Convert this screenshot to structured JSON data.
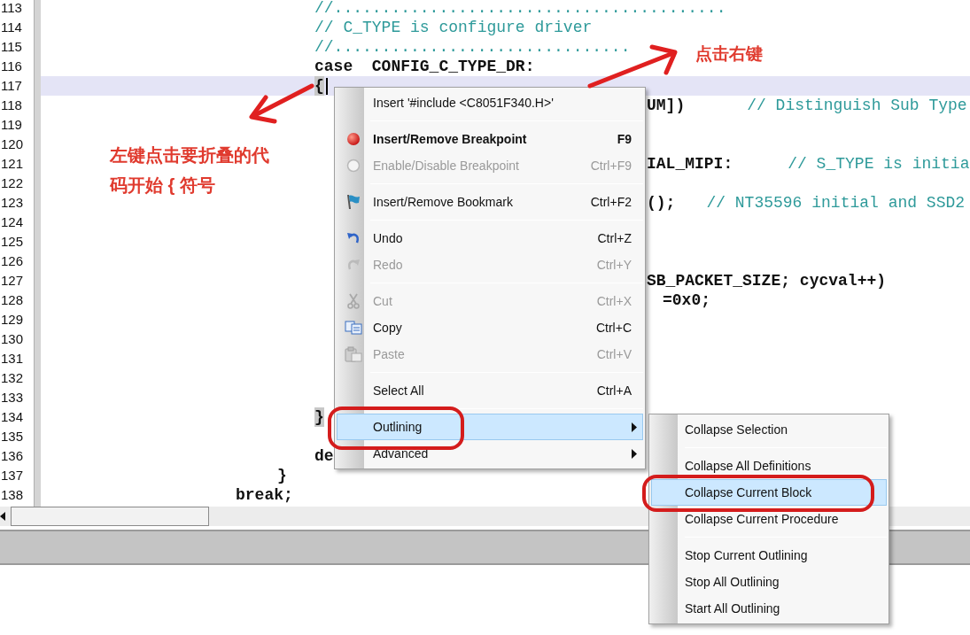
{
  "editor": {
    "lines": [
      {
        "number": "113",
        "current": false,
        "matched": false,
        "left": [
          {
            "kind": "comment",
            "text": "//........................................."
          }
        ]
      },
      {
        "number": "114",
        "current": false,
        "matched": false,
        "left": [
          {
            "kind": "comment",
            "text": "// C_TYPE is configure driver"
          }
        ]
      },
      {
        "number": "115",
        "current": false,
        "matched": false,
        "left": [
          {
            "kind": "comment",
            "text": "//..............................."
          }
        ]
      },
      {
        "number": "116",
        "current": false,
        "matched": false,
        "left": [
          {
            "kind": "code",
            "text": "case  CONFIG_C_TYPE_DR:"
          }
        ]
      },
      {
        "number": "117",
        "current": true,
        "matched": true,
        "left": [
          {
            "kind": "code",
            "text": "{"
          }
        ]
      },
      {
        "number": "118",
        "current": false,
        "matched": false,
        "right": [
          {
            "kind": "code",
            "text": "UM])"
          },
          {
            "kind": "comment",
            "text": "// Distinguish Sub Type"
          }
        ]
      },
      {
        "number": "119",
        "current": false,
        "matched": false
      },
      {
        "number": "120",
        "current": false,
        "matched": false
      },
      {
        "number": "121",
        "current": false,
        "matched": false,
        "right": [
          {
            "kind": "code",
            "text": "IAL_MIPI:"
          },
          {
            "kind": "comment",
            "text": "// S_TYPE is initia"
          }
        ]
      },
      {
        "number": "122",
        "current": false,
        "matched": false
      },
      {
        "number": "123",
        "current": false,
        "matched": false,
        "right": [
          {
            "kind": "code",
            "text": "();"
          },
          {
            "kind": "comment",
            "text": "// NT35596 initial and SSD2"
          }
        ]
      },
      {
        "number": "124",
        "current": false,
        "matched": false
      },
      {
        "number": "125",
        "current": false,
        "matched": false
      },
      {
        "number": "126",
        "current": false,
        "matched": false
      },
      {
        "number": "127",
        "current": false,
        "matched": false,
        "right": [
          {
            "kind": "code",
            "text": "SB_PACKET_SIZE; cycval++)"
          }
        ]
      },
      {
        "number": "128",
        "current": false,
        "matched": false,
        "right": [
          {
            "kind": "code",
            "text": "=0x0;"
          }
        ]
      },
      {
        "number": "129",
        "current": false,
        "matched": false
      },
      {
        "number": "130",
        "current": false,
        "matched": false
      },
      {
        "number": "131",
        "current": false,
        "matched": false
      },
      {
        "number": "132",
        "current": false,
        "matched": false
      },
      {
        "number": "133",
        "current": false,
        "matched": false
      },
      {
        "number": "134",
        "current": false,
        "matched": true,
        "left": [
          {
            "kind": "code",
            "text": "}"
          }
        ]
      },
      {
        "number": "135",
        "current": false,
        "matched": false
      },
      {
        "number": "136",
        "current": false,
        "matched": false,
        "left": [
          {
            "kind": "code",
            "text": "de"
          }
        ]
      },
      {
        "number": "137",
        "current": false,
        "matched": false,
        "left": [
          {
            "kind": "code",
            "text": "}"
          }
        ]
      },
      {
        "number": "138",
        "current": false,
        "matched": false,
        "left": [
          {
            "kind": "code",
            "text": "break;"
          }
        ]
      }
    ]
  },
  "context_menu": {
    "items": [
      {
        "kind": "item",
        "label": "Insert '#include <C8051F340.H>'",
        "disabled": false,
        "bold": false,
        "selected": false,
        "submenu": false
      },
      {
        "kind": "separator"
      },
      {
        "kind": "item",
        "label": "Insert/Remove Breakpoint",
        "shortcut": "F9",
        "disabled": false,
        "bold": true,
        "selected": false,
        "submenu": false
      },
      {
        "kind": "item",
        "label": "Enable/Disable Breakpoint",
        "shortcut": "Ctrl+F9",
        "disabled": true,
        "bold": false,
        "selected": false,
        "submenu": false
      },
      {
        "kind": "separator"
      },
      {
        "kind": "item",
        "label": "Insert/Remove Bookmark",
        "shortcut": "Ctrl+F2",
        "disabled": false,
        "bold": false,
        "selected": false,
        "submenu": false
      },
      {
        "kind": "separator"
      },
      {
        "kind": "item",
        "label": "Undo",
        "shortcut": "Ctrl+Z",
        "disabled": false,
        "bold": false,
        "selected": false,
        "submenu": false
      },
      {
        "kind": "item",
        "label": "Redo",
        "shortcut": "Ctrl+Y",
        "disabled": true,
        "bold": false,
        "selected": false,
        "submenu": false
      },
      {
        "kind": "separator"
      },
      {
        "kind": "item",
        "label": "Cut",
        "shortcut": "Ctrl+X",
        "disabled": true,
        "bold": false,
        "selected": false,
        "submenu": false
      },
      {
        "kind": "item",
        "label": "Copy",
        "shortcut": "Ctrl+C",
        "disabled": false,
        "bold": false,
        "selected": false,
        "submenu": false
      },
      {
        "kind": "item",
        "label": "Paste",
        "shortcut": "Ctrl+V",
        "disabled": true,
        "bold": false,
        "selected": false,
        "submenu": false
      },
      {
        "kind": "separator"
      },
      {
        "kind": "item",
        "label": "Select All",
        "shortcut": "Ctrl+A",
        "disabled": false,
        "bold": false,
        "selected": false,
        "submenu": false
      },
      {
        "kind": "separator"
      },
      {
        "kind": "item",
        "label": "Outlining",
        "disabled": false,
        "bold": false,
        "selected": true,
        "submenu": true
      },
      {
        "kind": "item",
        "label": "Advanced",
        "disabled": false,
        "bold": false,
        "selected": false,
        "submenu": true
      }
    ]
  },
  "submenu": {
    "items": [
      {
        "kind": "item",
        "label": "Collapse Selection",
        "selected": false
      },
      {
        "kind": "separator"
      },
      {
        "kind": "item",
        "label": "Collapse All Definitions",
        "selected": false
      },
      {
        "kind": "item",
        "label": "Collapse Current Block",
        "selected": true
      },
      {
        "kind": "item",
        "label": "Collapse Current Procedure",
        "selected": false
      },
      {
        "kind": "separator"
      },
      {
        "kind": "item",
        "label": "Stop Current Outlining",
        "selected": false
      },
      {
        "kind": "item",
        "label": "Stop All Outlining",
        "selected": false
      },
      {
        "kind": "item",
        "label": "Start All Outlining",
        "selected": false
      }
    ]
  },
  "annotations": {
    "left_note": "左键点击要折叠的代码开始 { 符号",
    "right_note": "点击右键"
  }
}
